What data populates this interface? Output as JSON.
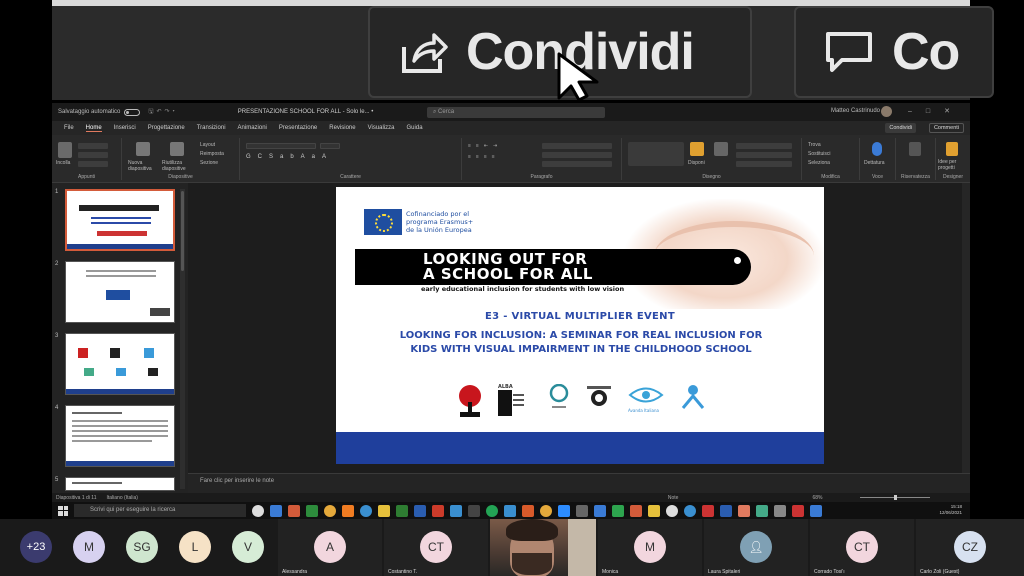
{
  "zoom_overlay": {
    "share_label": "Condividi",
    "comments_label": "Co"
  },
  "ppt": {
    "autosave_label": "Salvataggio automatico",
    "doc_title": "PRESENTAZIONE SCHOOL FOR ALL - Solo le...  •",
    "search_placeholder": "Cerca",
    "user_name": "Matteo Castrinudo",
    "tabs": [
      "File",
      "Home",
      "Inserisci",
      "Progettazione",
      "Transizioni",
      "Animazioni",
      "Presentazione",
      "Revisione",
      "Visualizza",
      "Guida"
    ],
    "share_label": "Condividi",
    "comments_label": "Commenti",
    "ribbon_groups": [
      "Appunti",
      "Diapositive",
      "Carattere",
      "Paragrafo",
      "Disegno",
      "Modifica",
      "Voce",
      "Riservatezza",
      "Designer"
    ],
    "ribbon_buttons": {
      "paste": "Incolla",
      "new_slide": "Nuova diapositiva",
      "reuse": "Riutilizza diapositive",
      "layout": "Layout",
      "reset": "Reimposta",
      "section": "Sezione",
      "shapes": "Forme",
      "arrange": "Disponi",
      "find": "Trova",
      "replace": "Sostituisci",
      "select": "Seleziona",
      "dictate": "Dettatura",
      "design_ideas": "Idee per progetti"
    },
    "thumbnail_numbers": [
      "1",
      "2",
      "3",
      "4",
      "5"
    ],
    "notes_placeholder": "Fare clic per inserire le note",
    "status": {
      "slide_counter": "Diapositiva 1 di 11",
      "language": "Italiano (Italia)",
      "notes": "Note",
      "zoom": "68%"
    },
    "taskbar": {
      "search_placeholder": "Scrivi qui per eseguire la ricerca",
      "time": "15:18",
      "date": "12/06/2021"
    }
  },
  "slide": {
    "eu_text": [
      "Cofinanciado por el",
      "programa Erasmus+",
      "de la Unión Europea"
    ],
    "banner_line1": "LOOKING OUT FOR",
    "banner_line2": "A SCHOOL FOR ALL",
    "subtitle": "early educational inclusion for students with low vision",
    "event": "E3 - VIRTUAL MULTIPLIER EVENT",
    "seminar": "LOOKING FOR INCLUSION: A SEMINAR FOR REAL INCLUSION FOR KIDS WITH VISUAL IMPAIRMENT IN THE CHILDHOOD SCHOOL",
    "logos": [
      "ALBA",
      "Avanda Italiana"
    ]
  },
  "participants": [
    {
      "initials": "+23",
      "color": "#3b3b6e"
    },
    {
      "initials": "M",
      "color": "#d7d1f0"
    },
    {
      "initials": "SG",
      "color": "#cfe6cf"
    },
    {
      "initials": "L",
      "color": "#f6e2c6"
    },
    {
      "initials": "V",
      "color": "#d6ecd6"
    },
    {
      "initials": "A",
      "name": "Alessandra",
      "color": "#f2d6de"
    },
    {
      "initials": "CT",
      "name": "Costantino T.",
      "color": "#f2d6de"
    },
    {
      "initials": "M",
      "name": "Monica",
      "color": "#f2d6de"
    },
    {
      "initials": "",
      "name": "Laura Spitaleri",
      "color": "#7fa0b4"
    },
    {
      "initials": "CT",
      "name": "Corrado Tosi'ı",
      "color": "#f2d6de"
    },
    {
      "initials": "CZ",
      "name": "Carlo Zoli (Guest)",
      "color": "#d7e1f0"
    }
  ]
}
